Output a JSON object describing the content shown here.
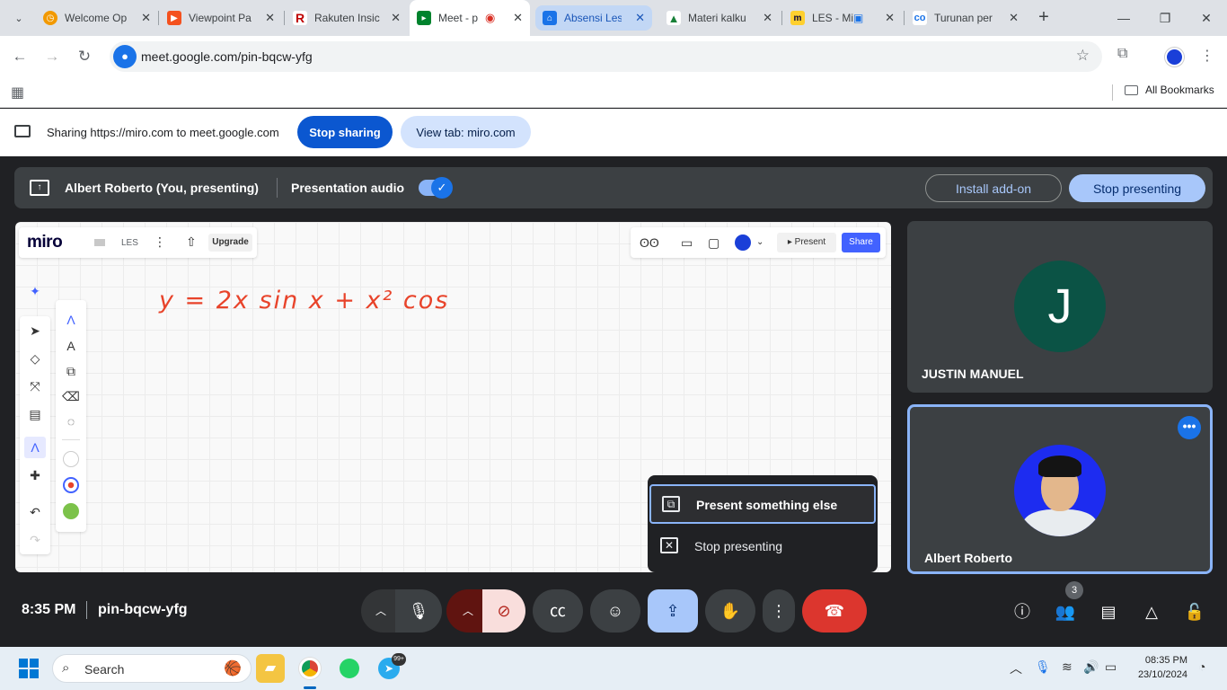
{
  "browser": {
    "tabs": [
      {
        "title": "Welcome Op",
        "icon": "clock-icon",
        "color": "#f29900"
      },
      {
        "title": "Viewpoint Pa",
        "icon": "viewpoint-icon",
        "color": "#f4511e"
      },
      {
        "title": "Rakuten Insic",
        "icon": "rakuten-icon",
        "color": "#bf0000"
      },
      {
        "title": "Meet - p",
        "icon": "meet-icon",
        "color": "#00832d"
      },
      {
        "title": "Absensi Les",
        "icon": "absensi-icon",
        "color": "#1a73e8"
      },
      {
        "title": "Materi kalku",
        "icon": "drive-icon",
        "color": "#188038"
      },
      {
        "title": "LES - Mi",
        "icon": "miro-icon",
        "color": "#ffd02f"
      },
      {
        "title": "Turunan per",
        "icon": "link-icon",
        "color": "#1a73e8"
      }
    ],
    "url": "meet.google.com/pin-bqcw-yfg",
    "all_bookmarks": "All Bookmarks"
  },
  "sharing_bar": {
    "text": "Sharing https://miro.com to meet.google.com",
    "stop_sharing": "Stop sharing",
    "view_tab": "View tab: miro.com"
  },
  "presenting_bar": {
    "presenter": "Albert Roberto (You, presenting)",
    "audio_label": "Presentation audio",
    "install_addon": "Install add-on",
    "stop_presenting": "Stop presenting"
  },
  "miro": {
    "logo": "miro",
    "board_name": "LES",
    "upgrade": "Upgrade",
    "present": "Present",
    "share": "Share",
    "handwriting": "y = 2x sin x  + x² cos"
  },
  "popup_menu": {
    "present_something_else": "Present something else",
    "stop_presenting": "Stop presenting"
  },
  "participants": [
    {
      "name": "JUSTIN MANUEL",
      "initial": "J"
    },
    {
      "name": "Albert Roberto"
    }
  ],
  "meet_controls": {
    "time": "8:35 PM",
    "meeting_code": "pin-bqcw-yfg",
    "people_count": "3"
  },
  "taskbar": {
    "search": "Search",
    "telegram_badge": "99+",
    "time": "08:35 PM",
    "date": "23/10/2024"
  }
}
